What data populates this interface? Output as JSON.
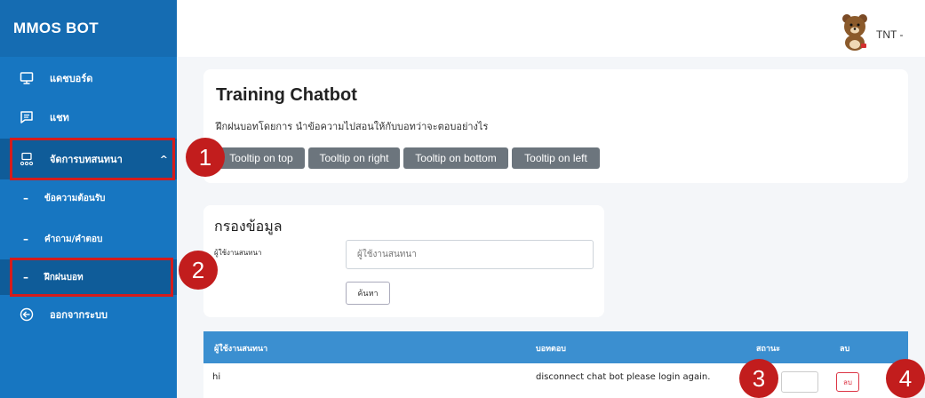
{
  "app": {
    "brand": "MMOS BOT"
  },
  "sidebar": {
    "items": [
      {
        "label": "แดชบอร์ด",
        "icon": "monitor-icon"
      },
      {
        "label": "แชท",
        "icon": "chat-icon"
      },
      {
        "label": "จัดการบทสนทนา",
        "icon": "manage-icon",
        "caret": "^"
      },
      {
        "label": "ข้อความต้อนรับ"
      },
      {
        "label": "คำถาม/คำตอบ"
      },
      {
        "label": "ฝึกฝนบอท"
      },
      {
        "label": "ออกจากระบบ",
        "icon": "logout-icon"
      }
    ],
    "dash": "–"
  },
  "header": {
    "user_name": "TNT -"
  },
  "training": {
    "title": "Training Chatbot",
    "subtitle": "ฝึกฝนบอทโดยการ นำข้อความไปสอนให้กับบอทว่าจะตอบอย่างไร",
    "buttons": [
      "Tooltip on top",
      "Tooltip on right",
      "Tooltip on bottom",
      "Tooltip on left"
    ]
  },
  "filter": {
    "title": "กรองข้อมูล",
    "label": "ผู้ใช้งานสนทนา",
    "placeholder": "ผู้ใช้งานสนทนา",
    "search_label": "ค้นหา"
  },
  "table": {
    "headers": [
      "ผู้ใช้งานสนทนา",
      "บอทตอบ",
      "สถานะ",
      "ลบ"
    ],
    "rows": [
      {
        "user": "hi",
        "bot_reply": "disconnect chat bot please login again.",
        "delete_label": "ลบ"
      }
    ]
  },
  "callouts": [
    "1",
    "2",
    "3",
    "4"
  ],
  "colors": {
    "sidebar": "#1776c1",
    "highlight": "#d41c1c",
    "callout": "#c21d1d",
    "table_header": "#3b8fd0"
  }
}
